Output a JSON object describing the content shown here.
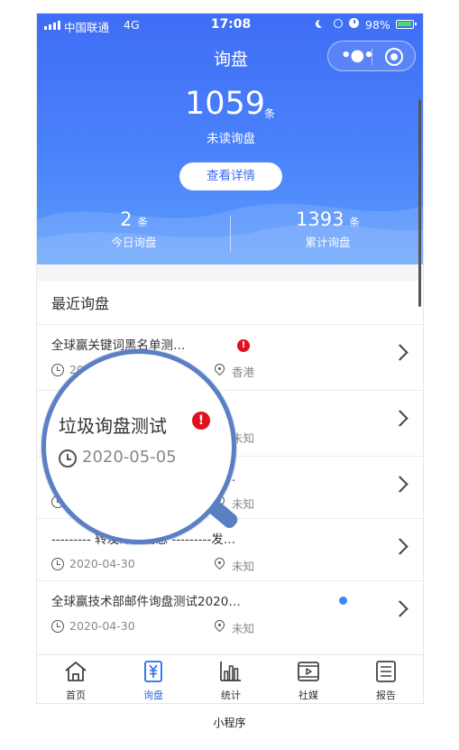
{
  "status": {
    "carrier": "中国联通",
    "network": "4G",
    "time": "17:08",
    "battery": "98%"
  },
  "nav": {
    "title": "询盘"
  },
  "summary": {
    "unread_count": "1059",
    "unit": "条",
    "unread_label": "未读询盘",
    "detail_button": "查看详情",
    "today": {
      "count": "2",
      "unit": "条",
      "label": "今日询盘"
    },
    "total": {
      "count": "1393",
      "unit": "条",
      "label": "累计询盘"
    }
  },
  "section": {
    "title": "最近询盘"
  },
  "inquiries": [
    {
      "title": "全球赢关键词黑名单测…",
      "date": "2020-05-05",
      "location": "香港"
    },
    {
      "title": "垃圾询盘测试",
      "date": "2020-05-05",
      "location": "未知"
    },
    {
      "title": "--------- 转发邮件信息 ---------发…",
      "date": "2020-04-30",
      "location": "未知"
    },
    {
      "title": "--------- 转发邮件信息 ---------发…",
      "date": "2020-04-30",
      "location": "未知"
    },
    {
      "title": "全球赢技术部邮件询盘测试2020…",
      "date": "2020-04-30",
      "location": "未知"
    }
  ],
  "tabs": [
    {
      "label": "首页",
      "icon": "home-icon"
    },
    {
      "label": "询盘",
      "icon": "yuan-document-icon"
    },
    {
      "label": "统计",
      "icon": "bar-chart-icon"
    },
    {
      "label": "社媒",
      "icon": "video-icon"
    },
    {
      "label": "报告",
      "icon": "report-icon"
    }
  ],
  "colors": {
    "primary": "#3f6df6",
    "alert": "#e0101d",
    "unread_dot": "#3d87f5",
    "tab_active": "#2a6ae8"
  },
  "caption": "小程序"
}
